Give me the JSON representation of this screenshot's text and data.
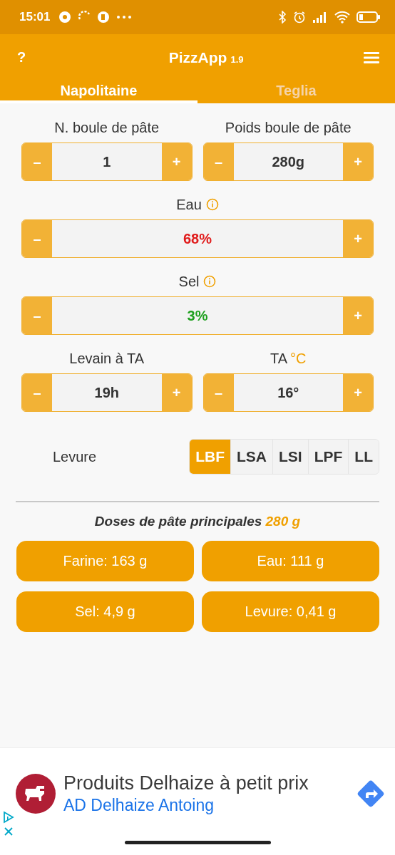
{
  "status_bar": {
    "time": "15:01"
  },
  "app_bar": {
    "help": "?",
    "title": "PizzApp",
    "version": "1.9"
  },
  "tabs": [
    {
      "label": "Napolitaine",
      "selected": true
    },
    {
      "label": "Teglia",
      "selected": false
    }
  ],
  "stepper_rows": [
    {
      "fields": [
        {
          "label": "N. boule de pâte",
          "info": false,
          "minus": "–",
          "value": "1",
          "plus": "+",
          "color": "#333333"
        },
        {
          "label": "Poids boule de pâte",
          "info": false,
          "minus": "–",
          "value": "280g",
          "plus": "+",
          "color": "#333333"
        }
      ]
    },
    {
      "fields": [
        {
          "label": "Eau",
          "info": true,
          "minus": "–",
          "value": "68%",
          "plus": "+",
          "color": "#e01b1b"
        }
      ]
    },
    {
      "fields": [
        {
          "label": "Sel",
          "info": true,
          "minus": "–",
          "value": "3%",
          "plus": "+",
          "color": "#1ea01e"
        }
      ]
    },
    {
      "fields": [
        {
          "label": "Levain à TA",
          "info": false,
          "minus": "–",
          "value": "19h",
          "plus": "+",
          "color": "#333333"
        },
        {
          "label": "TA",
          "unit": "°C",
          "info": false,
          "minus": "–",
          "value": "16°",
          "plus": "+",
          "color": "#333333"
        }
      ]
    }
  ],
  "yeast": {
    "label": "Levure",
    "options": [
      {
        "label": "LBF",
        "selected": true
      },
      {
        "label": "LSA",
        "selected": false
      },
      {
        "label": "LSI",
        "selected": false
      },
      {
        "label": "LPF",
        "selected": false
      },
      {
        "label": "LL",
        "selected": false
      }
    ]
  },
  "doses": {
    "title": "Doses de pâte principales",
    "total": "280 g",
    "items": [
      "Farine: 163 g",
      "Eau: 111 g",
      "Sel: 4,9 g",
      "Levure: 0,41 g"
    ]
  },
  "ad": {
    "title": "Produits Delhaize à petit prix",
    "subtitle": "AD Delhaize Antoing"
  }
}
